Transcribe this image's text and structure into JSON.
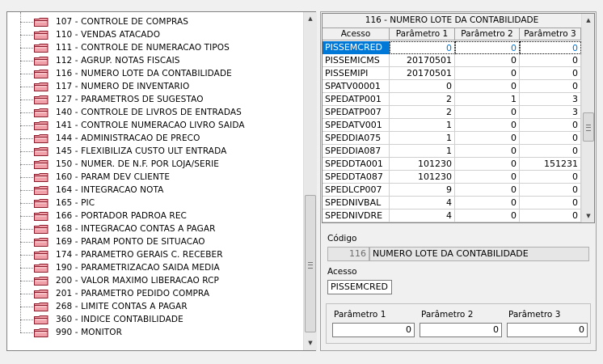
{
  "tree": {
    "items": [
      "107 - CONTROLE DE COMPRAS",
      "110 - VENDAS ATACADO",
      "111 - CONTROLE DE NUMERACAO TIPOS",
      "112 - AGRUP. NOTAS FISCAIS",
      "116 - NUMERO LOTE DA CONTABILIDADE",
      "117 - NUMERO DE INVENTARIO",
      "127 - PARAMETROS DE SUGESTAO",
      "140 - CONTROLE DE LIVROS DE ENTRADAS",
      "141 - CONTROLE NUMERACAO LIVRO SAIDA",
      "144 - ADMINISTRACAO DE PRECO",
      "145 - FLEXIBILIZA CUSTO ULT ENTRADA",
      "150 - NUMER. DE N.F. POR LOJA/SERIE",
      "160 - PARAM DEV CLIENTE",
      "164 - INTEGRACAO NOTA",
      "165 - PIC",
      "166 - PORTADOR PADROA REC",
      "168 - INTEGRACAO CONTAS A PAGAR",
      "169 - PARAM PONTO DE SITUACAO",
      "174 - PARAMETRO GERAIS C. RECEBER",
      "190 - PARAMETRIZACAO SAIDA MEDIA",
      "200 - VALOR MAXIMO LIBERACAO RCP",
      "201 - PARAMETRO PEDIDO COMPRA",
      "268 - LIMITE CONTAS A PAGAR",
      "360 - INDICE CONTABILIDADE",
      "990 - MONITOR"
    ]
  },
  "grid": {
    "title": "116 - NUMERO LOTE DA CONTABILIDADE",
    "columns": [
      "Acesso",
      "Parâmetro 1",
      "Parâmetro 2",
      "Parâmetro 3"
    ],
    "selected_row": 0,
    "rows": [
      [
        "PISSEMCRED",
        "0",
        "0",
        "0"
      ],
      [
        "PISSEMICMS",
        "20170501",
        "0",
        "0"
      ],
      [
        "PISSEMIPI",
        "20170501",
        "0",
        "0"
      ],
      [
        "SPATV00001",
        "0",
        "0",
        "0"
      ],
      [
        "SPEDATP001",
        "2",
        "1",
        "3"
      ],
      [
        "SPEDATP007",
        "2",
        "0",
        "3"
      ],
      [
        "SPEDATV001",
        "1",
        "0",
        "0"
      ],
      [
        "SPEDDIA075",
        "1",
        "0",
        "0"
      ],
      [
        "SPEDDIA087",
        "1",
        "0",
        "0"
      ],
      [
        "SPEDDTA001",
        "101230",
        "0",
        "151231"
      ],
      [
        "SPEDDTA087",
        "101230",
        "0",
        "0"
      ],
      [
        "SPEDLCP007",
        "9",
        "0",
        "0"
      ],
      [
        "SPEDNIVBAL",
        "4",
        "0",
        "0"
      ],
      [
        "SPEDNIVDRE",
        "4",
        "0",
        "0"
      ]
    ]
  },
  "form": {
    "codigo_label": "Código",
    "codigo_value": "116",
    "descricao_value": "NUMERO LOTE DA CONTABILIDADE",
    "acesso_label": "Acesso",
    "acesso_value": "PISSEMCRED",
    "param1_label": "Parâmetro 1",
    "param1_value": "0",
    "param2_label": "Parâmetro 2",
    "param2_value": "0",
    "param3_label": "Parâmetro 3",
    "param3_value": "0"
  },
  "icons": {
    "folder": "folder-icon",
    "scroll_up": "scroll-up-arrow-icon",
    "scroll_down": "scroll-down-arrow-icon"
  },
  "colors": {
    "selection": "#0078d7",
    "folder_fill": "#f0a0a8",
    "folder_stroke": "#8b1a2a"
  }
}
